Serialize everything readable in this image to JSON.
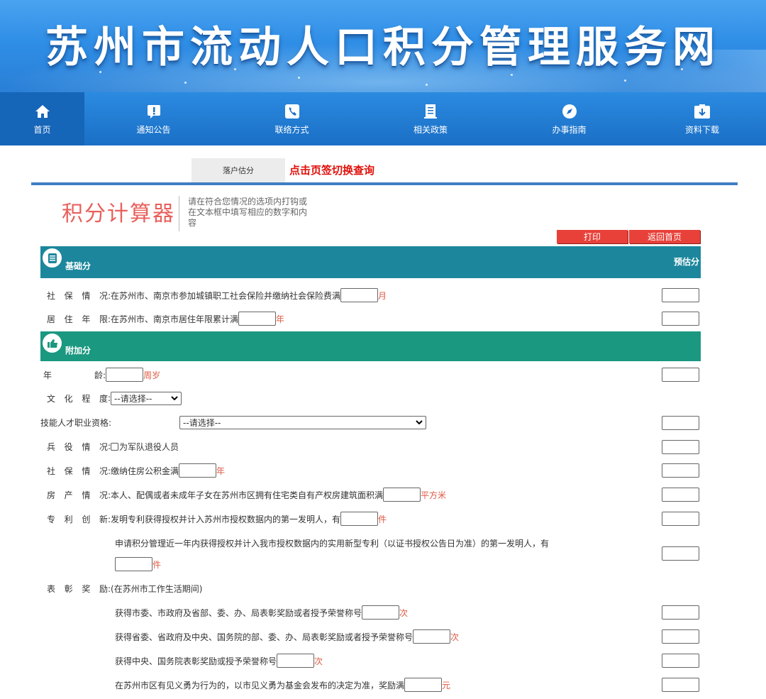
{
  "banner": {
    "title": "苏州市流动人口积分管理服务网"
  },
  "nav": [
    {
      "label": "首页",
      "icon": "home-icon"
    },
    {
      "label": "通知公告",
      "icon": "notice-icon"
    },
    {
      "label": "联络方式",
      "icon": "phone-icon"
    },
    {
      "label": "相关政策",
      "icon": "document-icon"
    },
    {
      "label": "办事指南",
      "icon": "compass-icon"
    },
    {
      "label": "资料下载",
      "icon": "download-icon"
    }
  ],
  "tab": {
    "label": "落户估分",
    "hint": "点击页签切换查询"
  },
  "calculator": {
    "title": "积分计算器",
    "description": "请在符合您情况的选项内打钩或在文本框中填写相应的数字和内容",
    "print_label": "打印",
    "home_label": "返回首页"
  },
  "basic": {
    "title": "基础分",
    "score_header": "预估分",
    "social_label": [
      "社",
      "保",
      "情",
      "况"
    ],
    "social_text": ":在苏州市、南京市参加城镇职工社会保险并缴纳社会保险费满",
    "social_unit": "月",
    "residence_label": [
      "居",
      "住",
      "年",
      "限"
    ],
    "residence_text": ":在苏州市、南京市居住年限累计满",
    "residence_unit": "年"
  },
  "extra": {
    "title": "附加分",
    "age_label_a": "年",
    "age_label_b": "龄:",
    "age_unit": "周岁",
    "education_label": [
      "文",
      "化",
      "程",
      "度"
    ],
    "education_select": "--请选择--",
    "skill_label": "技能人才职业资格:",
    "skill_select": "--请选择--",
    "military_label": [
      "兵",
      "役",
      "情",
      "况"
    ],
    "military_text": "为军队退役人员",
    "housing_fund_label": [
      "社",
      "保",
      "情",
      "况"
    ],
    "housing_fund_text": ":缴纳住房公积金满",
    "housing_fund_unit": "年",
    "property_label": [
      "房",
      "产",
      "情",
      "况"
    ],
    "property_text": ":本人、配偶或者未成年子女在苏州市区拥有住宅类自有产权房建筑面积满",
    "property_unit": "平方米",
    "patent_label": [
      "专",
      "利",
      "创",
      "新"
    ],
    "patent_text": ":发明专利获得授权并计入苏州市授权数据内的第一发明人，有",
    "patent_unit": "件",
    "utility_text": "申请积分管理近一年内获得授权并计入我市授权数据内的实用新型专利（以证书授权公告日为准）的第一发明人，有",
    "utility_unit": "件",
    "award_label": [
      "表",
      "彰",
      "奖",
      "励"
    ],
    "award_text": ":(在苏州市工作生活期间)",
    "award_city_text": "获得市委、市政府及省部、委、办、局表彰奖励或者授予荣誉称号",
    "award_city_unit": "次",
    "award_prov_text": "获得省委、省政府及中央、国务院的部、委、办、局表彰奖励或者授予荣誉称号",
    "award_prov_unit": "次",
    "award_central_text": "获得中央、国务院表彰奖励或授予荣誉称号",
    "award_central_unit": "次",
    "bravery_text": "在苏州市区有见义勇为行为的，以市见义勇为基金会发布的决定为准，奖励满",
    "bravery_unit": "元"
  },
  "colors": {
    "accent_red": "#e8413a",
    "section_basic": "#1c879c",
    "section_extra": "#1a9880",
    "nav_blue": "#1a6fc6"
  }
}
